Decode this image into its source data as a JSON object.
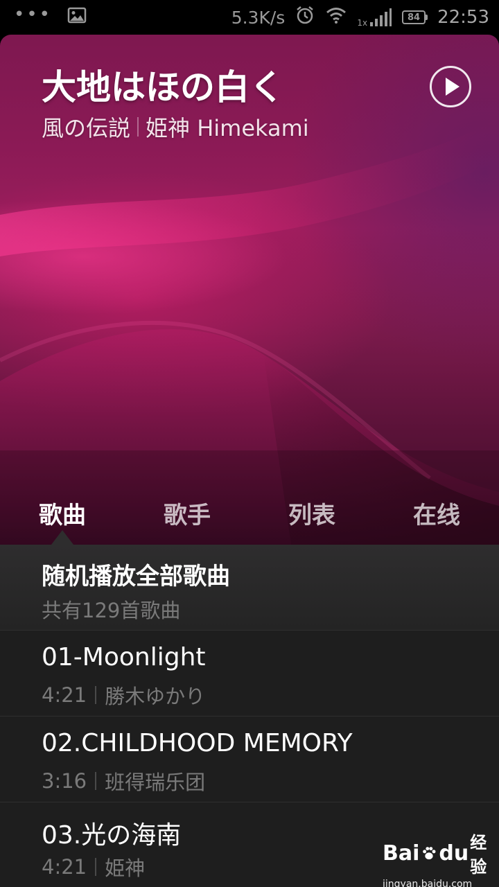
{
  "status_bar": {
    "dots": "•••",
    "speed": "5.3K/s",
    "sim_label": "1x",
    "battery": "84",
    "time": "22:53",
    "icons": [
      "gallery-icon",
      "alarm-icon",
      "wifi-icon",
      "signal-icon",
      "battery-icon"
    ]
  },
  "now_playing": {
    "title": "大地はほの白く",
    "album": "風の伝説",
    "artist": "姫神 Himekami"
  },
  "tabs": [
    {
      "label": "歌曲",
      "active": true
    },
    {
      "label": "歌手",
      "active": false
    },
    {
      "label": "列表",
      "active": false
    },
    {
      "label": "在线",
      "active": false
    }
  ],
  "shuffle": {
    "label": "随机播放全部歌曲",
    "count_text": "共有129首歌曲"
  },
  "songs": [
    {
      "title": "01-Moonlight",
      "duration": "4:21",
      "artist": "勝木ゆかり"
    },
    {
      "title": "02.CHILDHOOD MEMORY",
      "duration": "3:16",
      "artist": "班得瑞乐团"
    },
    {
      "title": "03.光の海南",
      "duration": "4:21",
      "artist": "姫神"
    }
  ],
  "watermark": {
    "brand_a": "Bai",
    "brand_b": "du",
    "brand_c": "经验",
    "url": "jingyan.baidu.com"
  },
  "colors": {
    "hero_accent": "#d9246f",
    "list_bg": "#1e1e1e",
    "secondary_text": "#7a7a7a"
  }
}
